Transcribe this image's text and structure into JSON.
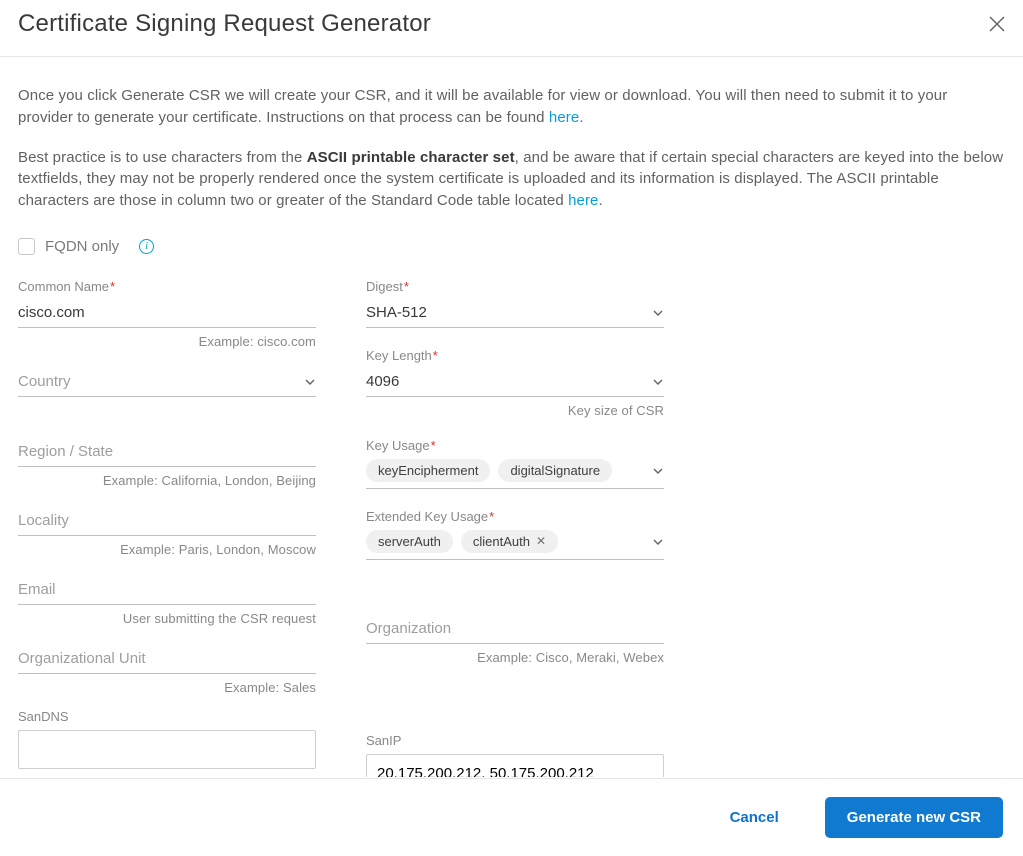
{
  "header": {
    "title": "Certificate Signing Request Generator"
  },
  "intro": {
    "p1_a": "Once you click Generate CSR we will create your CSR, and it will be available for view or download. You will then need to submit it to your provider to generate your certificate. Instructions on that process can be found ",
    "p1_link": "here",
    "p1_b": ".",
    "p2_a": "Best practice is to use characters from the ",
    "p2_bold": "ASCII printable character set",
    "p2_b": ", and be aware that if certain special characters are keyed into the below textfields, they may not be properly rendered once the system certificate is uploaded and its information is displayed. The ASCII printable characters are those in column two or greater of the Standard Code table located ",
    "p2_link": "here",
    "p2_c": "."
  },
  "fqdn": {
    "label": "FQDN only"
  },
  "left": {
    "common_name": {
      "label": "Common Name",
      "value": "cisco.com",
      "hint": "Example: cisco.com"
    },
    "country": {
      "placeholder": "Country"
    },
    "region": {
      "placeholder": "Region / State",
      "hint": "Example: California, London, Beijing"
    },
    "locality": {
      "placeholder": "Locality",
      "hint": "Example: Paris, London, Moscow"
    },
    "email": {
      "placeholder": "Email",
      "hint": "User submitting the CSR request"
    },
    "org_unit": {
      "placeholder": "Organizational Unit",
      "hint": "Example: Sales"
    },
    "san_dns": {
      "label": "SanDNS",
      "value": ""
    }
  },
  "right": {
    "digest": {
      "label": "Digest",
      "value": "SHA-512"
    },
    "key_length": {
      "label": "Key Length",
      "value": "4096",
      "hint": "Key size of CSR"
    },
    "key_usage": {
      "label": "Key Usage",
      "tags": [
        "keyEncipherment",
        "digitalSignature"
      ]
    },
    "ext_key_usage": {
      "label": "Extended Key Usage",
      "tags": [
        "serverAuth",
        "clientAuth"
      ],
      "removable_last": true
    },
    "organization": {
      "placeholder": "Organization",
      "hint": "Example: Cisco, Meraki, Webex"
    },
    "san_ip": {
      "label": "SanIP",
      "value": "20.175.200.212, 50.175.200.212"
    }
  },
  "footer": {
    "cancel": "Cancel",
    "generate": "Generate new CSR"
  }
}
